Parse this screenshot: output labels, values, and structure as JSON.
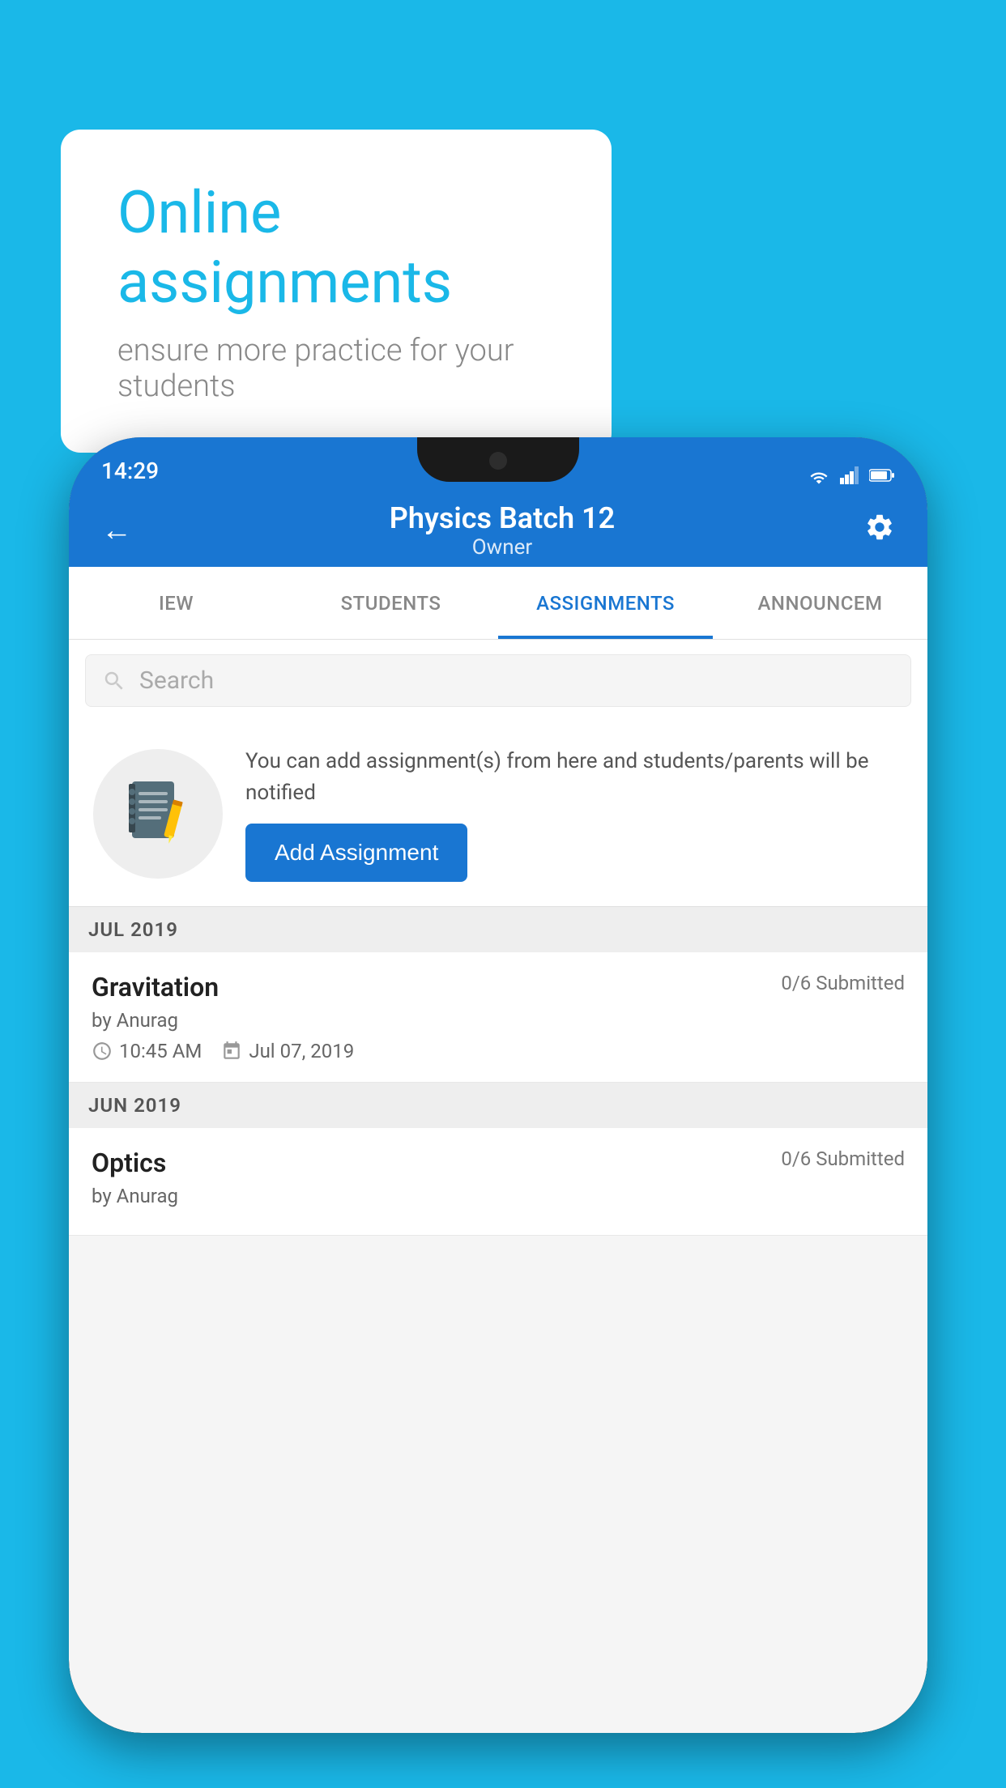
{
  "background_color": "#1ab8e8",
  "speech_bubble": {
    "title": "Online assignments",
    "subtitle": "ensure more practice for your students"
  },
  "phone": {
    "status_bar": {
      "time": "14:29",
      "icons": [
        "wifi",
        "signal",
        "battery"
      ]
    },
    "app_bar": {
      "title": "Physics Batch 12",
      "subtitle": "Owner",
      "back_label": "←",
      "settings_label": "⚙"
    },
    "tabs": [
      {
        "label": "IEW",
        "active": false
      },
      {
        "label": "STUDENTS",
        "active": false
      },
      {
        "label": "ASSIGNMENTS",
        "active": true
      },
      {
        "label": "ANNOUNCEM",
        "active": false
      }
    ],
    "search": {
      "placeholder": "Search"
    },
    "promo": {
      "description": "You can add assignment(s) from here and students/parents will be notified",
      "button_label": "Add Assignment"
    },
    "sections": [
      {
        "header": "JUL 2019",
        "assignments": [
          {
            "name": "Gravitation",
            "submitted": "0/6 Submitted",
            "by": "by Anurag",
            "time": "10:45 AM",
            "date": "Jul 07, 2019"
          }
        ]
      },
      {
        "header": "JUN 2019",
        "assignments": [
          {
            "name": "Optics",
            "submitted": "0/6 Submitted",
            "by": "by Anurag",
            "time": "",
            "date": ""
          }
        ]
      }
    ]
  }
}
